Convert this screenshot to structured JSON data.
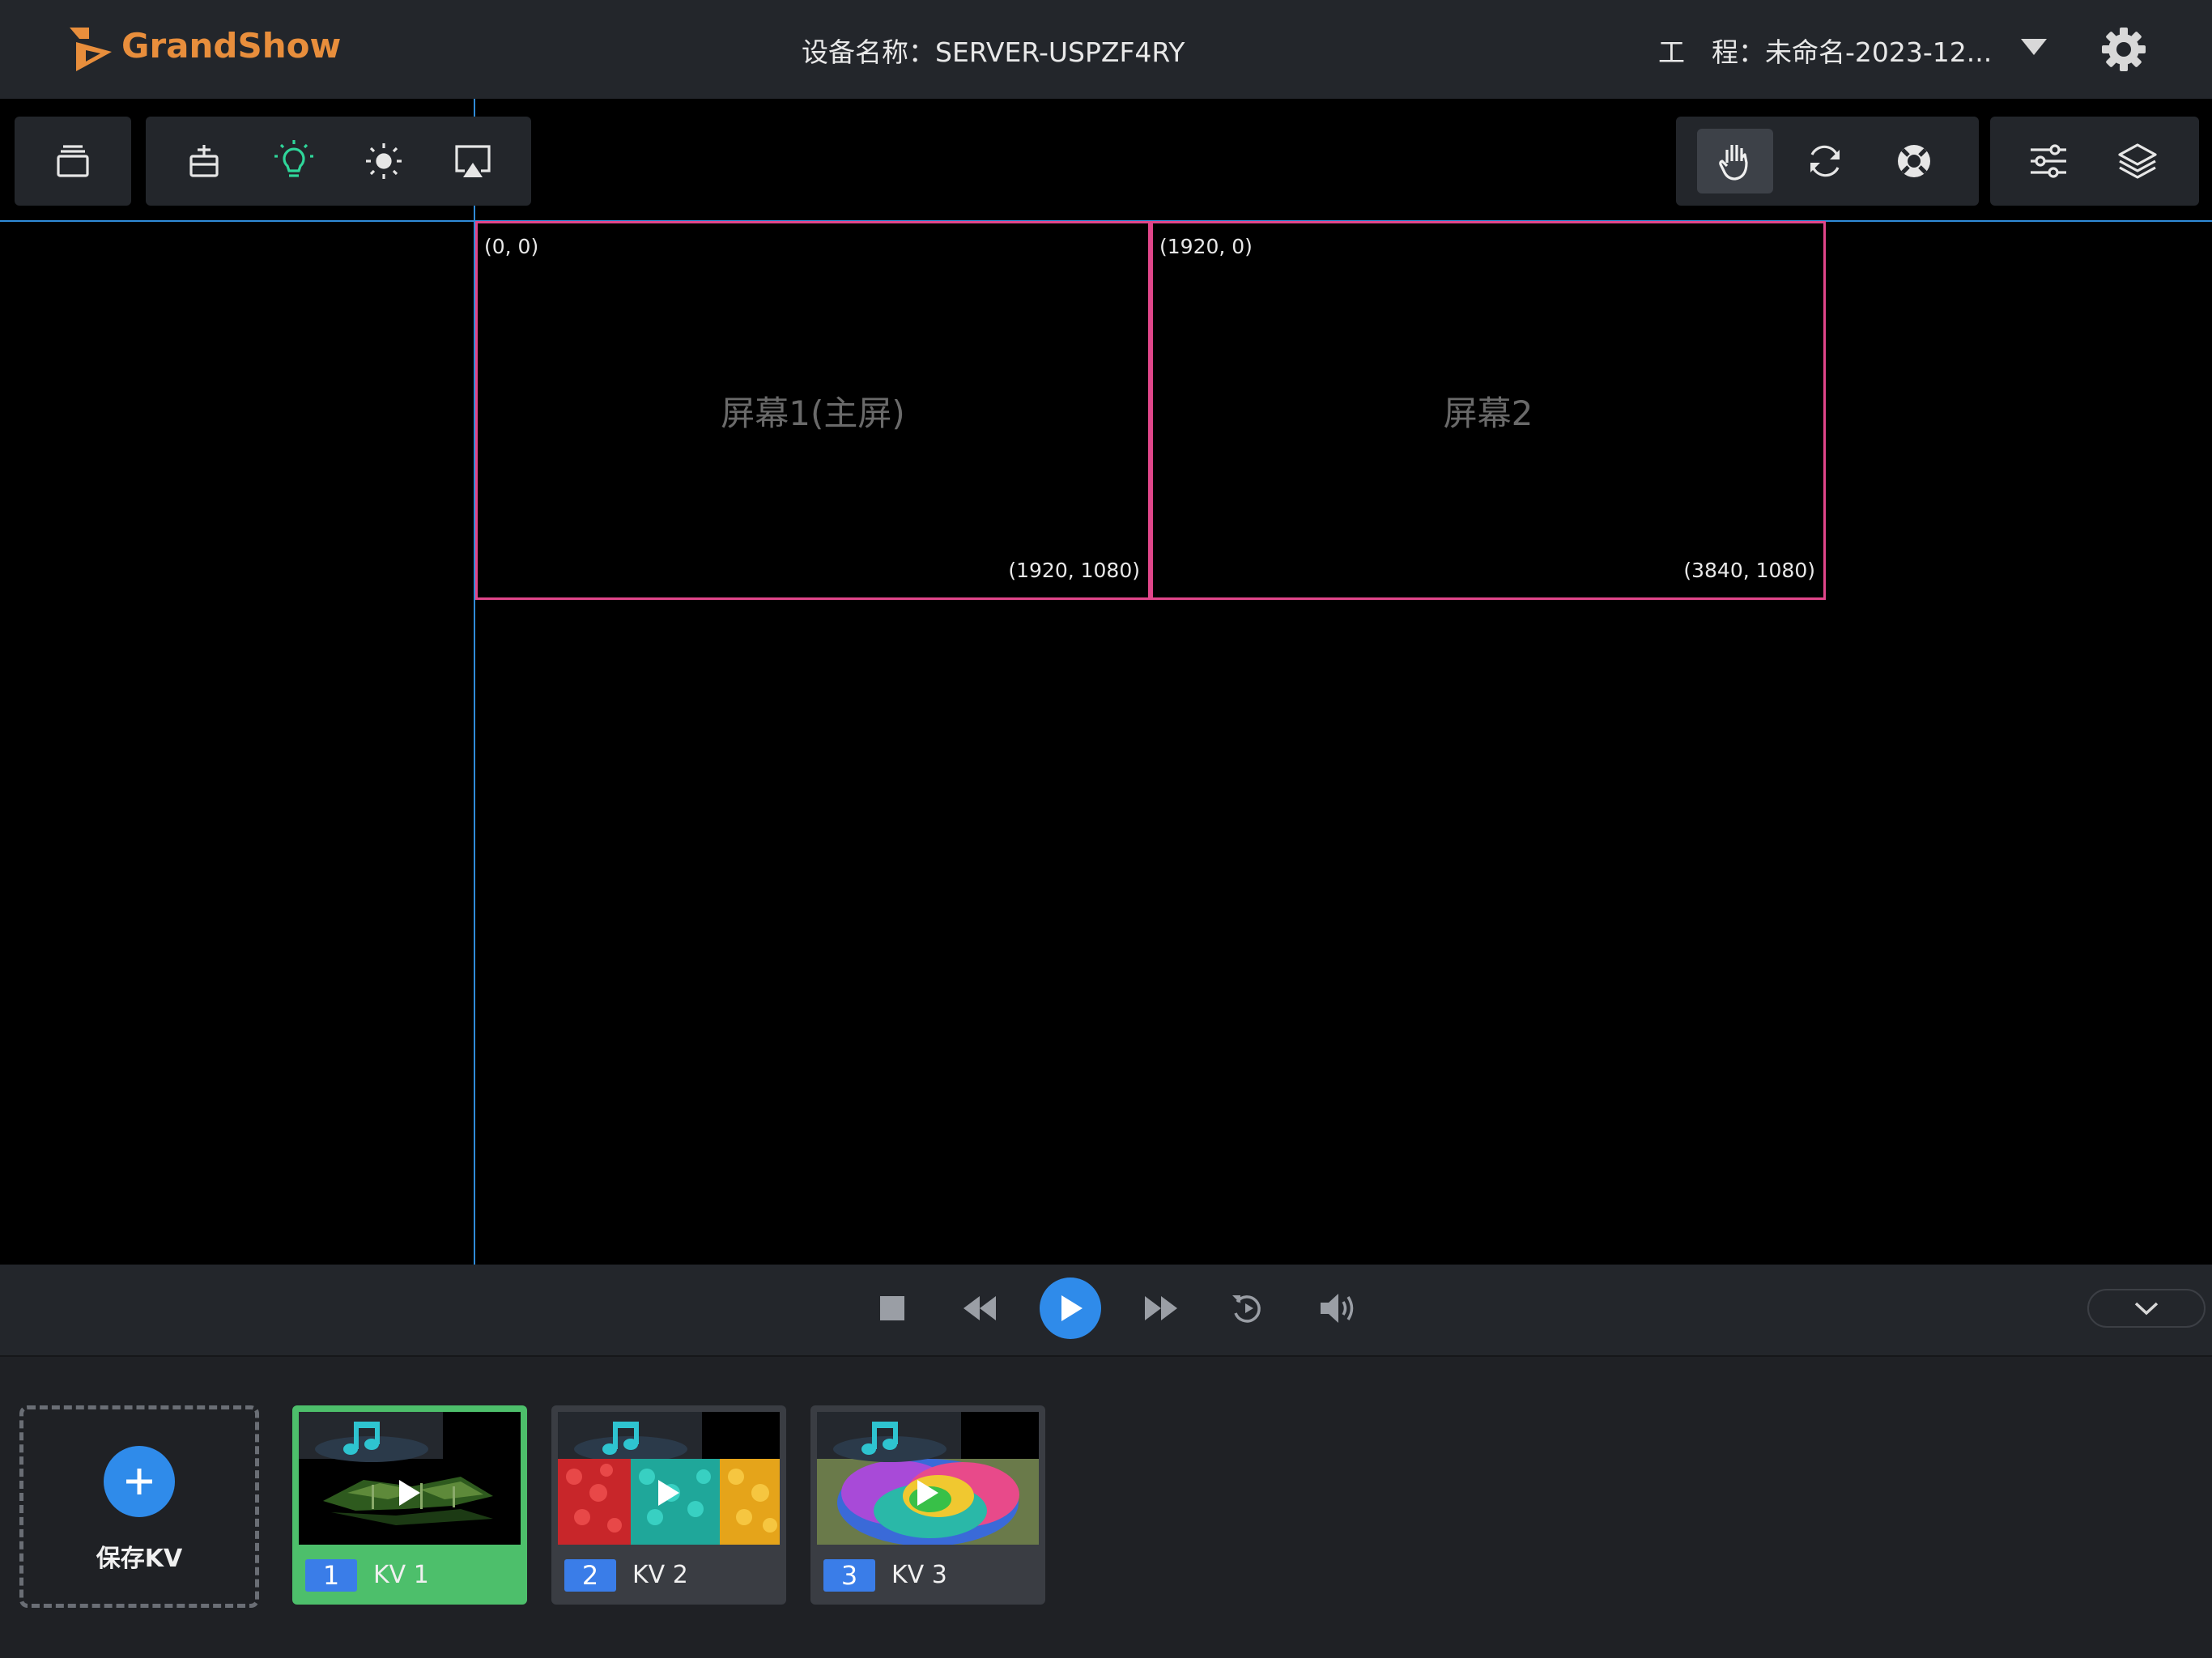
{
  "header": {
    "brand": "GrandShow",
    "device_label": "设备名称：",
    "device_name": "SERVER-USPZF4RY",
    "project_label": "工　程：",
    "project_name": "未命名-2023-12..."
  },
  "screens": [
    {
      "label": "屏幕1(主屏)",
      "top_left": "(0, 0)",
      "bottom_right": "(1920, 1080)"
    },
    {
      "label": "屏幕2",
      "top_left": "(1920, 0)",
      "bottom_right": "(3840, 1080)"
    }
  ],
  "kv": {
    "save_label": "保存KV",
    "items": [
      {
        "num": "1",
        "name": "KV 1",
        "selected": true
      },
      {
        "num": "2",
        "name": "KV 2",
        "selected": false
      },
      {
        "num": "3",
        "name": "KV 3",
        "selected": false
      }
    ]
  },
  "colors": {
    "brand": "#e88e3c",
    "accent": "#2f8bea",
    "screen_border": "#e1468a",
    "selected": "#4dbf6b",
    "guide": "#2f8bd8"
  },
  "icons": {
    "toolbar_left": [
      "window-stack-icon",
      "basket-icon",
      "lightbulb-icon",
      "brightness-icon",
      "airplay-icon"
    ],
    "toolbar_right": [
      "hand-icon",
      "refresh-icon",
      "lifebuoy-icon",
      "sliders-icon",
      "layers-icon"
    ],
    "playback": [
      "stop-icon",
      "rewind-icon",
      "play-icon",
      "fast-forward-icon",
      "replay-icon",
      "volume-icon",
      "chevron-down-icon"
    ]
  }
}
